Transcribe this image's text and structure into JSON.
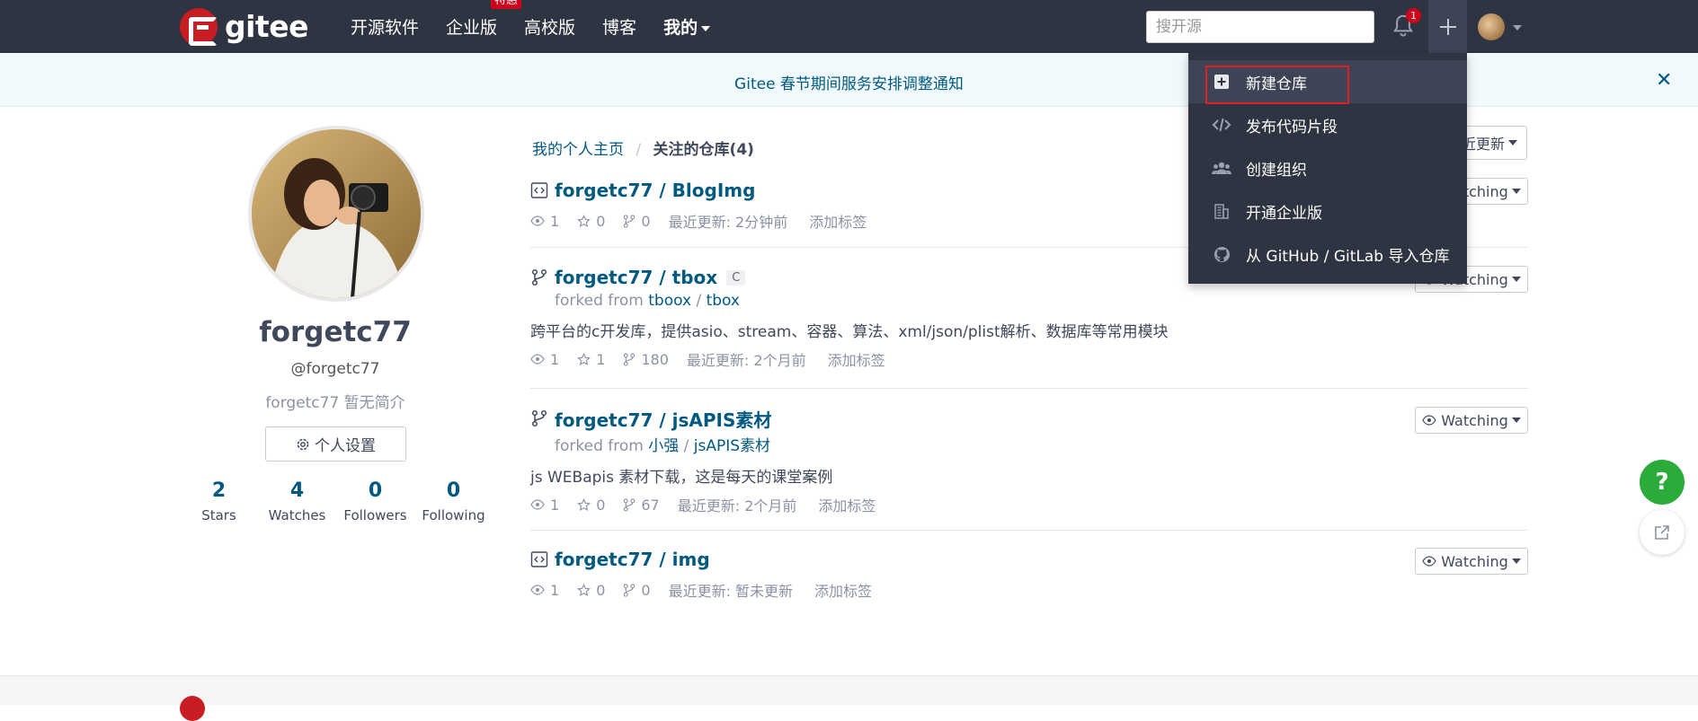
{
  "header": {
    "logo_text": "gitee",
    "nav": [
      {
        "label": "开源软件"
      },
      {
        "label": "企业版",
        "badge": "特惠"
      },
      {
        "label": "高校版"
      },
      {
        "label": "博客"
      },
      {
        "label": "我的"
      }
    ],
    "search_placeholder": "搜开源",
    "notification_count": "1"
  },
  "notice": {
    "text": "Gitee 春节期间服务安排调整通知",
    "close": "✕"
  },
  "profile": {
    "name": "forgetc77",
    "handle": "@forgetc77",
    "bio": "forgetc77 暂无简介",
    "settings_label": "个人设置",
    "stats": [
      {
        "value": "2",
        "label": "Stars"
      },
      {
        "value": "4",
        "label": "Watches"
      },
      {
        "value": "0",
        "label": "Followers"
      },
      {
        "value": "0",
        "label": "Following"
      }
    ]
  },
  "breadcrumb": {
    "home": "我的个人主页",
    "separator": "/",
    "current": "关注的仓库(4)"
  },
  "sort_label": "近更新",
  "repos": [
    {
      "name": "forgetc77 / BlogImg",
      "icon": "repo-code-icon",
      "watchers": "1",
      "stars": "0",
      "forks": "0",
      "updated": "最近更新: 2分钟前",
      "add_tag": "添加标签",
      "watch_label": "Watching"
    },
    {
      "name": "forgetc77 / tbox",
      "icon": "fork-icon",
      "lang": "C",
      "forked_prefix": "forked from",
      "forked_owner": "tboox",
      "forked_sep": "/",
      "forked_repo": "tbox",
      "description": "跨平台的c开发库，提供asio、stream、容器、算法、xml/json/plist解析、数据库等常用模块",
      "watchers": "1",
      "stars": "1",
      "forks": "180",
      "updated": "最近更新: 2个月前",
      "add_tag": "添加标签",
      "watch_label": "Watching"
    },
    {
      "name": "forgetc77 / jsAPIS素材",
      "icon": "fork-icon",
      "forked_prefix": "forked from",
      "forked_owner": "小强",
      "forked_sep": "/",
      "forked_repo": "jsAPIS素材",
      "description": "js WEBapis 素材下载，这是每天的课堂案例",
      "watchers": "1",
      "stars": "0",
      "forks": "67",
      "updated": "最近更新: 2个月前",
      "add_tag": "添加标签",
      "watch_label": "Watching"
    },
    {
      "name": "forgetc77 / img",
      "icon": "repo-code-icon",
      "watchers": "1",
      "stars": "0",
      "forks": "0",
      "updated": "最近更新: 暂未更新",
      "add_tag": "添加标签",
      "watch_label": "Watching"
    }
  ],
  "dropdown": [
    {
      "label": "新建仓库",
      "icon": "plus-square-icon"
    },
    {
      "label": "发布代码片段",
      "icon": "code-icon"
    },
    {
      "label": "创建组织",
      "icon": "group-icon"
    },
    {
      "label": "开通企业版",
      "icon": "building-icon"
    },
    {
      "label": "从 GitHub / GitLab 导入仓库",
      "icon": "github-icon"
    }
  ],
  "help_label": "?",
  "colors": {
    "header_bg": "#2e3441",
    "link": "#005980",
    "brand_red": "#c71d23",
    "help_green": "#2aab3a",
    "highlight": "#e02020"
  }
}
